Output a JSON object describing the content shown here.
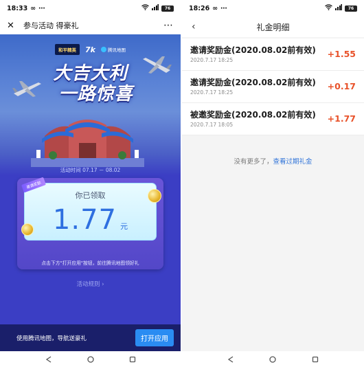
{
  "left": {
    "status_bar": {
      "time": "18:33",
      "extra": "∞",
      "battery": "76"
    },
    "titlebar": {
      "title": "参与活动 得豪礼",
      "close": "✕",
      "more": "⋯"
    },
    "hero": {
      "logo_game": "和平精英",
      "logo_ds": "7k",
      "logo_map": "腾讯地图",
      "title_line1": "大吉大利",
      "title_line2": "一路惊喜",
      "activity_time": "活动时间 07.17 － 08.02"
    },
    "card": {
      "tag": "邀请奖励",
      "label": "你已领取",
      "amount": "1.77",
      "unit": "元",
      "hint": "点击下方\"打开应用\"按钮，前往腾讯地图领好礼"
    },
    "rules_link": "活动规则 ›",
    "bottom_bar": {
      "text": "使用腾讯地图，导航送豪礼",
      "button": "打开应用"
    }
  },
  "right": {
    "status_bar": {
      "time": "18:26",
      "extra": "∞",
      "battery": "76"
    },
    "header": {
      "title": "礼金明细",
      "back": "‹"
    },
    "items": [
      {
        "title": "邀请奖励金(2020.08.02前有效)",
        "date": "2020.7.17 18:25",
        "amount": "+1.55"
      },
      {
        "title": "邀请奖励金(2020.08.02前有效)",
        "date": "2020.7.17 18:25",
        "amount": "+0.17"
      },
      {
        "title": "被邀奖励金(2020.08.02前有效)",
        "date": "2020.7.17 18:05",
        "amount": "+1.77"
      }
    ],
    "footer": {
      "text": "没有更多了，",
      "link": "查看过期礼金"
    }
  }
}
